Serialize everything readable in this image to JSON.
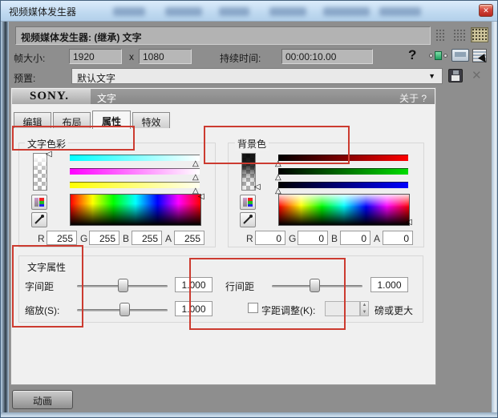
{
  "window": {
    "title": "视频媒体发生器"
  },
  "header": {
    "title": "视频媒体发生器: (继承) 文字"
  },
  "frame": {
    "size_label": "帧大小:",
    "width": "1920",
    "times": "x",
    "height": "1080",
    "duration_label": "持续时间:",
    "duration_value": "00:00:10.00"
  },
  "preset": {
    "label": "预置:",
    "value": "默认文字"
  },
  "plugin": {
    "brand": "SONY.",
    "name": "文字",
    "about": "关于 ?",
    "tabs": [
      {
        "label": "编辑"
      },
      {
        "label": "布局"
      },
      {
        "label": "属性"
      },
      {
        "label": "特效"
      }
    ]
  },
  "channel_labels": {
    "r": "R",
    "g": "G",
    "b": "B",
    "a": "A"
  },
  "text_color": {
    "label": "文字色彩",
    "r": "255",
    "g": "255",
    "b": "255",
    "a": "255"
  },
  "background_color": {
    "label": "背景色",
    "r": "0",
    "g": "0",
    "b": "0",
    "a": "0"
  },
  "text_props": {
    "label": "文字属性",
    "tracking_label": "字间距",
    "tracking_value": "1.000",
    "scale_label": "缩放(S):",
    "scale_value": "1.000",
    "leading_label": "行间距",
    "leading_value": "1.000",
    "kerning_label": "字距调整(K):",
    "kerning_value": "",
    "kerning_suffix": "磅或更大"
  },
  "footer": {
    "animate_label": "动画"
  },
  "icons": {
    "close": "✕",
    "help": "?",
    "dropdown_arrow": "▼",
    "delete": "✕",
    "tri_up": "△",
    "tri_left": "◁",
    "spin_up": "▲",
    "spin_down": "▼"
  },
  "colors": {
    "annotation_red": "#cc3b30",
    "titlebar_blue": "#bfd9f0",
    "close_button_red": "#d2443a",
    "pressed_icon_bg": "#cdc49b",
    "dialog_gray": "#8e8e8e",
    "panel_bg": "#f0f0f0"
  }
}
